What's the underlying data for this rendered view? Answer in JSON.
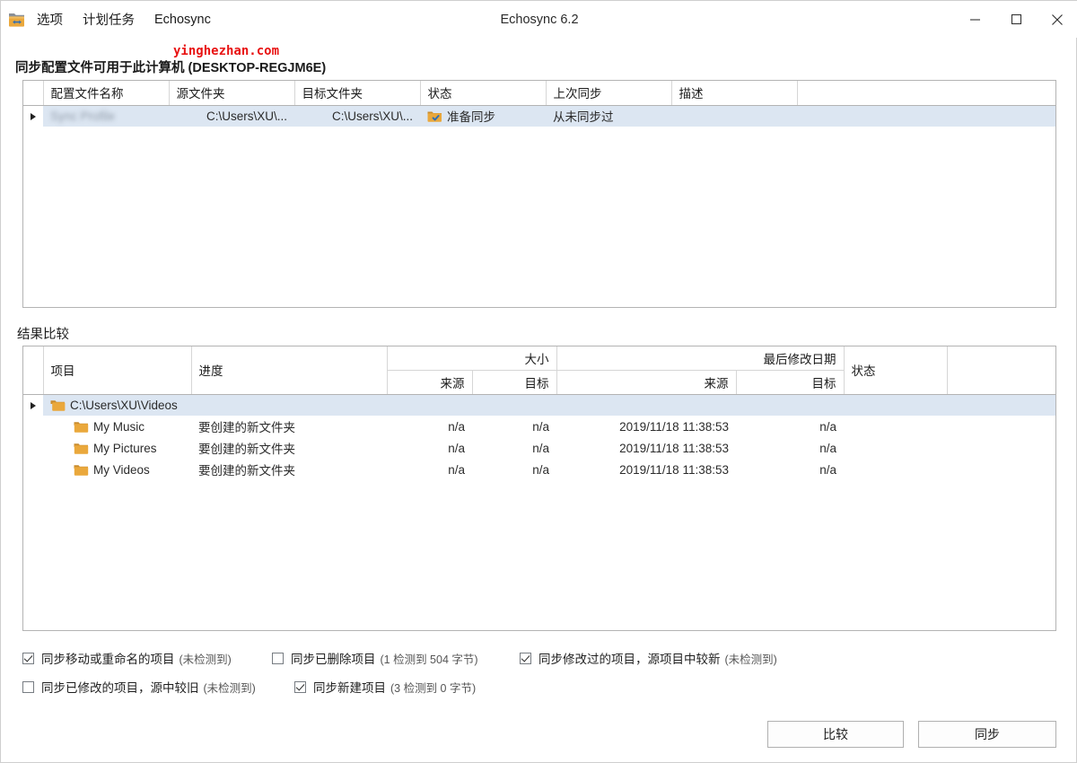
{
  "window": {
    "title": "Echosync 6.2",
    "icon": "folder-sync-icon",
    "minimize_label": "–",
    "maximize_label": "□",
    "close_label": "✕"
  },
  "menu": {
    "items": [
      {
        "label": "选项",
        "name": "menu-options"
      },
      {
        "label": "计划任务",
        "name": "menu-scheduled-tasks"
      },
      {
        "label": "Echosync",
        "name": "menu-echosync"
      }
    ]
  },
  "watermark": "yinghezhan.com",
  "profiles": {
    "heading": "同步配置文件可用于此计算机 (DESKTOP-REGJM6E)",
    "columns": [
      "配置文件名称",
      "源文件夹",
      "目标文件夹",
      "状态",
      "上次同步",
      "描述",
      ""
    ],
    "rows": [
      {
        "selected": true,
        "name": "",
        "source": "C:\\Users\\XU\\...",
        "target": "C:\\Users\\XU\\...",
        "status": "准备同步",
        "status_icon": "folder-check-icon",
        "last_sync": "从未同步过",
        "description": ""
      }
    ]
  },
  "results": {
    "heading": "结果比较",
    "columns": {
      "item": "项目",
      "progress": "进度",
      "size_group": "大小",
      "size_source": "来源",
      "size_target": "目标",
      "date_group": "最后修改日期",
      "date_source": "来源",
      "date_target": "目标",
      "status": "状态",
      "extra": ""
    },
    "rows": [
      {
        "kind": "root",
        "expander": true,
        "icon": "folder-open-icon",
        "item": "C:\\Users\\XU\\Videos",
        "progress": "",
        "size_source": "",
        "size_target": "",
        "date_source": "",
        "date_target": "",
        "status": "",
        "selected": true
      },
      {
        "kind": "child",
        "expander": false,
        "icon": "folder-icon",
        "item": "My Music",
        "progress": "要创建的新文件夹",
        "size_source": "n/a",
        "size_target": "n/a",
        "date_source": "2019/11/18 11:38:53",
        "date_target": "n/a",
        "status": "",
        "selected": false
      },
      {
        "kind": "child",
        "expander": false,
        "icon": "folder-icon",
        "item": "My Pictures",
        "progress": "要创建的新文件夹",
        "size_source": "n/a",
        "size_target": "n/a",
        "date_source": "2019/11/18 11:38:53",
        "date_target": "n/a",
        "status": "",
        "selected": false
      },
      {
        "kind": "child",
        "expander": false,
        "icon": "folder-icon",
        "item": "My Videos",
        "progress": "要创建的新文件夹",
        "size_source": "n/a",
        "size_target": "n/a",
        "date_source": "2019/11/18 11:38:53",
        "date_target": "n/a",
        "status": "",
        "selected": false
      }
    ]
  },
  "options": [
    {
      "name": "sync-moved-renamed",
      "checked": true,
      "label": "同步移动或重命名的项目",
      "note": "(未检测到)"
    },
    {
      "name": "sync-deleted",
      "checked": false,
      "label": "同步已删除项目",
      "note": "(1 检测到 504 字节)"
    },
    {
      "name": "sync-modified-newer-in-source",
      "checked": true,
      "label": "同步修改过的项目，源项目中较新",
      "note": "(未检测到)"
    },
    {
      "name": "sync-modified-older-in-source",
      "checked": false,
      "label": "同步已修改的项目，源中较旧",
      "note": "(未检测到)"
    },
    {
      "name": "sync-new",
      "checked": true,
      "label": "同步新建项目",
      "note": "(3 检测到 0 字节)"
    }
  ],
  "actions": {
    "compare": "比较",
    "sync": "同步"
  },
  "colors": {
    "selection": "#dce6f2",
    "folder": "#eaa83c",
    "accent_blue": "#2b6cb0",
    "watermark_red": "#e81212",
    "border": "#b3b3b3"
  }
}
